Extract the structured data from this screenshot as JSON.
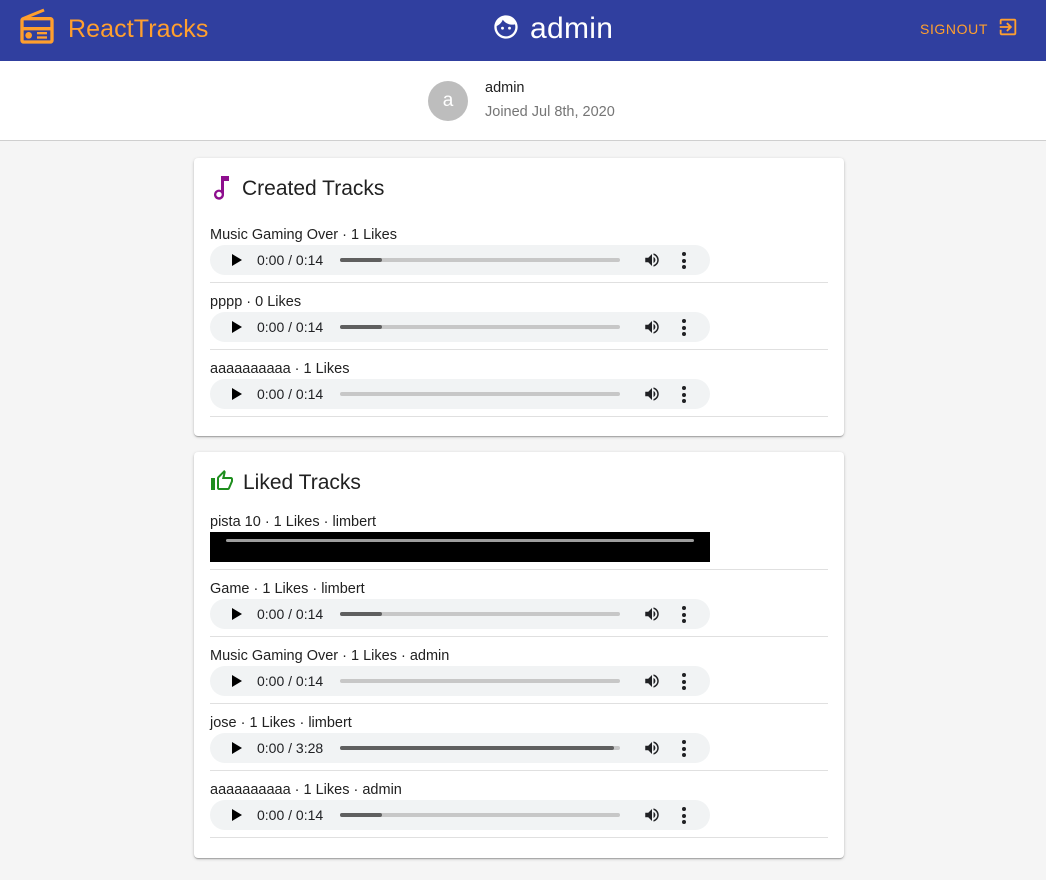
{
  "appbar": {
    "brand": "ReactTracks",
    "username": "admin",
    "signout_label": "SIGNOUT"
  },
  "profile": {
    "avatar_letter": "a",
    "name": "admin",
    "joined": "Joined Jul 8th, 2020"
  },
  "created": {
    "title": "Created Tracks",
    "tracks": [
      {
        "label": "Music Gaming Over · 1 Likes",
        "time": "0:00 / 0:14",
        "progress": 0.15
      },
      {
        "label": "pppp · 0 Likes",
        "time": "0:00 / 0:14",
        "progress": 0.15
      },
      {
        "label": "aaaaaaaaaa · 1 Likes",
        "time": "0:00 / 0:14",
        "progress": 0.0
      }
    ]
  },
  "liked": {
    "title": "Liked Tracks",
    "tracks": [
      {
        "label": "pista 10 · 1 Likes · limbert",
        "video": true
      },
      {
        "label": "Game · 1 Likes · limbert",
        "time": "0:00 / 0:14",
        "progress": 0.15
      },
      {
        "label": "Music Gaming Over · 1 Likes · admin",
        "time": "0:00 / 0:14",
        "progress": 0.0
      },
      {
        "label": "jose · 1 Likes · limbert",
        "time": "0:00 / 3:28",
        "progress": 0.98
      },
      {
        "label": "aaaaaaaaaa · 1 Likes · admin",
        "time": "0:00 / 0:14",
        "progress": 0.15
      }
    ]
  },
  "colors": {
    "appbar": "#303f9f",
    "accent": "#ff9f2e",
    "music_icon": "#8e0e8e",
    "thumb_icon": "#1e8e1e"
  },
  "icons": {
    "brand": "radio-icon",
    "user": "face-icon",
    "signout": "exit-icon",
    "created": "music-note-icon",
    "liked": "thumb-up-icon"
  }
}
